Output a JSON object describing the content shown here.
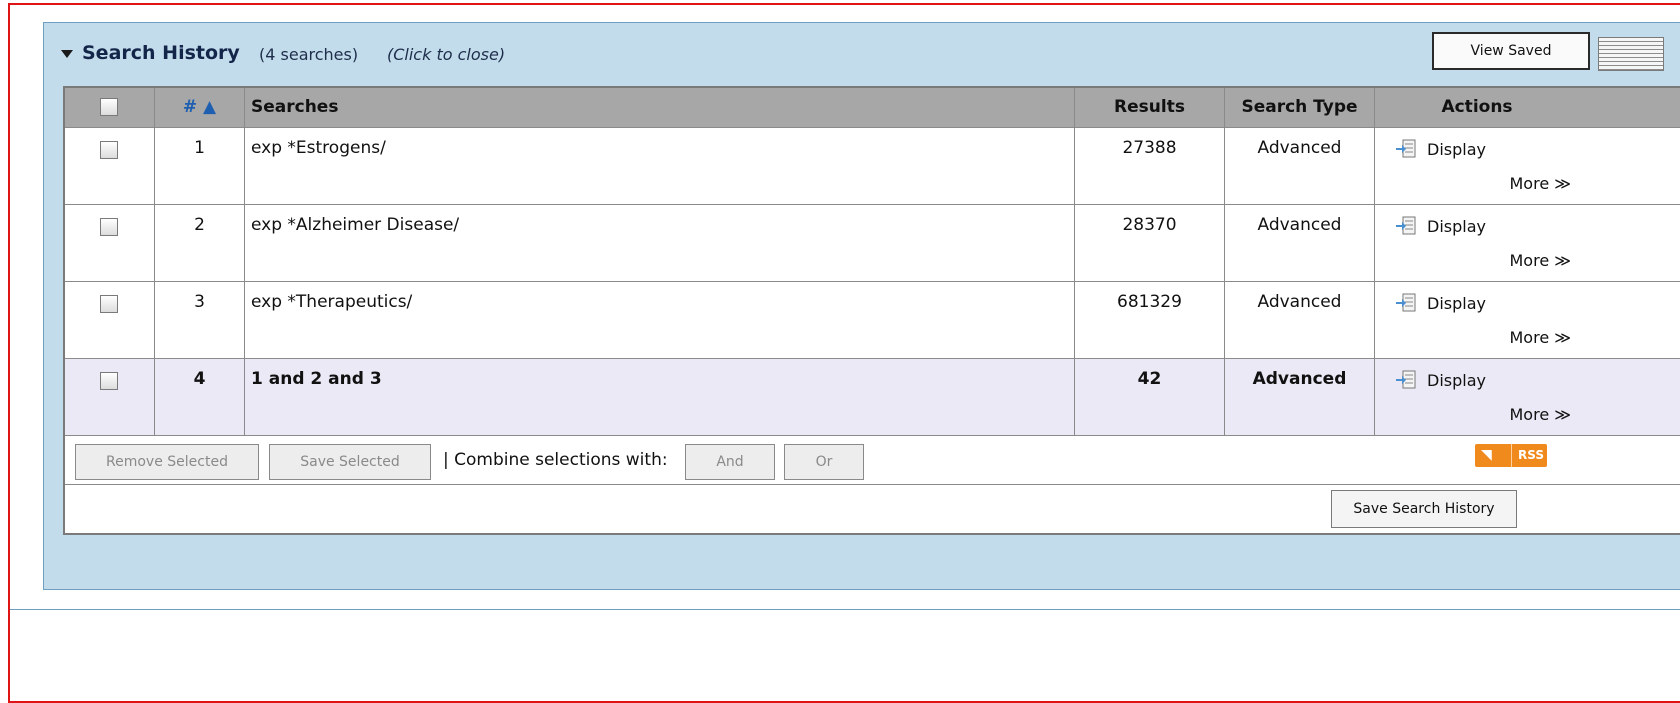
{
  "panel": {
    "title": "Search History",
    "count_text": "(4 searches)",
    "close_hint": "(Click to close)",
    "view_saved_label": "View Saved"
  },
  "table": {
    "headers": {
      "num": "# ▲",
      "searches": "Searches",
      "results": "Results",
      "type": "Search Type",
      "actions": "Actions"
    },
    "rows": [
      {
        "num": "1",
        "search": "exp *Estrogens/",
        "results": "27388",
        "type": "Advanced",
        "display": "Display",
        "more": "More ≫"
      },
      {
        "num": "2",
        "search": "exp *Alzheimer Disease/",
        "results": "28370",
        "type": "Advanced",
        "display": "Display",
        "more": "More ≫"
      },
      {
        "num": "3",
        "search": "exp *Therapeutics/",
        "results": "681329",
        "type": "Advanced",
        "display": "Display",
        "more": "More ≫"
      },
      {
        "num": "4",
        "search": "1 and 2 and 3",
        "results": "42",
        "type": "Advanced",
        "display": "Display",
        "more": "More ≫"
      }
    ]
  },
  "actions": {
    "remove_selected": "Remove Selected",
    "save_selected": "Save Selected",
    "combine_label": "| Combine selections with:",
    "and_label": "And",
    "or_label": "Or",
    "rss_label": "RSS",
    "save_history_label": "Save Search History"
  },
  "colors": {
    "panel_background": "#c3dcec",
    "frame_border": "#e01414",
    "selected_row": "#ebe9f5",
    "rss_orange": "#f08a1c",
    "sort_link": "#1f5fb0"
  }
}
